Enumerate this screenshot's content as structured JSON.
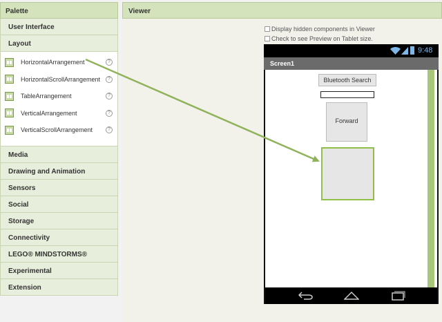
{
  "palette": {
    "title": "Palette",
    "categories_top": [
      "User Interface",
      "Layout"
    ],
    "layout_components": [
      {
        "label": "HorizontalArrangement",
        "icon": "horizontal-arrangement-icon"
      },
      {
        "label": "HorizontalScrollArrangement",
        "icon": "horizontal-scroll-arrangement-icon"
      },
      {
        "label": "TableArrangement",
        "icon": "table-arrangement-icon"
      },
      {
        "label": "VerticalArrangement",
        "icon": "vertical-arrangement-icon"
      },
      {
        "label": "VerticalScrollArrangement",
        "icon": "vertical-scroll-arrangement-icon"
      }
    ],
    "help_glyph": "?",
    "categories_bottom": [
      "Media",
      "Drawing and Animation",
      "Sensors",
      "Social",
      "Storage",
      "Connectivity",
      "LEGO® MINDSTORMS®",
      "Experimental",
      "Extension"
    ]
  },
  "viewer": {
    "title": "Viewer",
    "option_hidden": "Display hidden components in Viewer",
    "option_tablet": "Check to see Preview on Tablet size."
  },
  "phone": {
    "time": "9:48",
    "screen_title": "Screen1",
    "bluetooth_button": "Bluetooth Search",
    "forward_button": "Forward"
  },
  "colors": {
    "accent": "#8fbf46",
    "header": "#d5e3bd",
    "arrow": "#8fb25a"
  }
}
